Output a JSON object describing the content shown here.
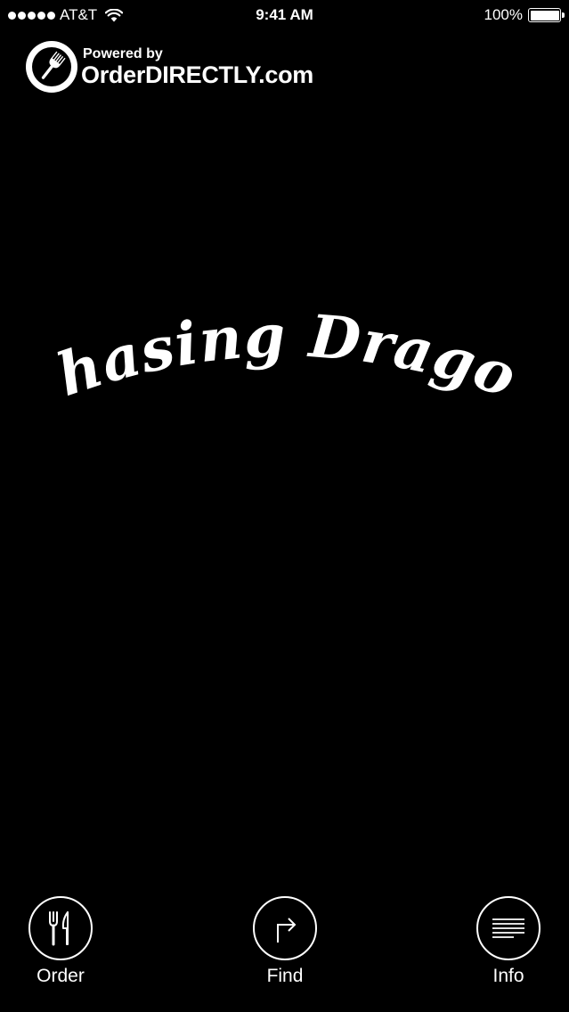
{
  "status_bar": {
    "carrier": "AT&T",
    "time": "9:41 AM",
    "battery_percent": "100%",
    "battery_level": 1.0,
    "signal_bars": 5
  },
  "powered_logo": {
    "line1": "Powered by",
    "line2": "OrderDIRECTLY.com"
  },
  "restaurant": {
    "name": "Chasing Dragon"
  },
  "bottom_nav": {
    "items": [
      {
        "label": "Order",
        "icon": "utensils-icon"
      },
      {
        "label": "Find",
        "icon": "turn-right-arrow-icon"
      },
      {
        "label": "Info",
        "icon": "lines-menu-icon"
      }
    ]
  },
  "colors": {
    "background": "#000000",
    "foreground": "#ffffff"
  }
}
